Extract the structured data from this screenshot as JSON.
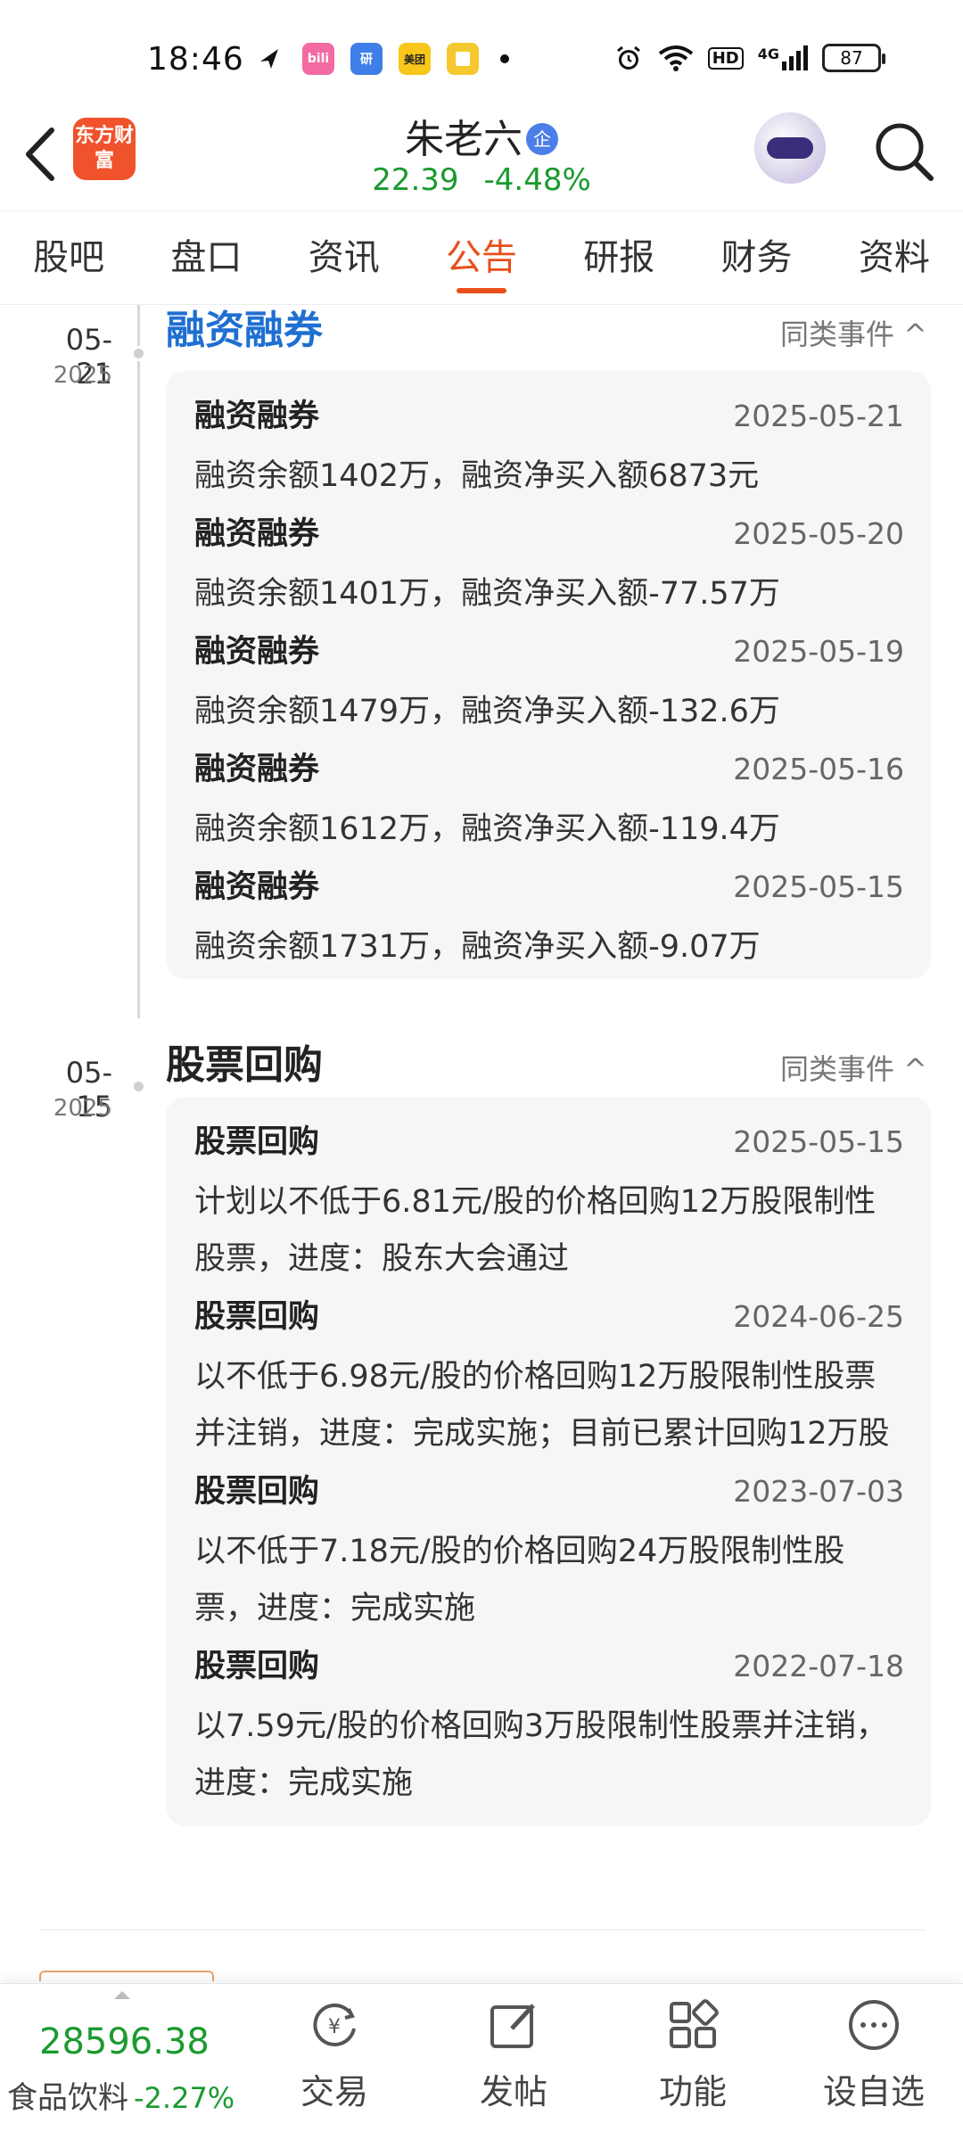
{
  "status_bar": {
    "time": "18:46",
    "app_icons": [
      "send-icon",
      "bilibili-icon",
      "research-app-icon",
      "meituan-icon",
      "notes-icon"
    ],
    "app_labels": [
      "",
      "bili",
      "研",
      "美团",
      ""
    ],
    "network": "4G",
    "hd": "HD",
    "battery": "87"
  },
  "header": {
    "logo_text": "东方财富",
    "stock_name": "朱老六",
    "enterprise_badge": "企",
    "price": "22.39",
    "change": "-4.48%"
  },
  "tabs": [
    {
      "label": "股吧",
      "active": false
    },
    {
      "label": "盘口",
      "active": false
    },
    {
      "label": "资讯",
      "active": false
    },
    {
      "label": "公告",
      "active": true
    },
    {
      "label": "研报",
      "active": false
    },
    {
      "label": "财务",
      "active": false
    },
    {
      "label": "资料",
      "active": false
    }
  ],
  "events": [
    {
      "date": "05-21",
      "year": "2025",
      "title": "融资融券",
      "title_color": "#1f6fd1",
      "similar_label": "同类事件 ^",
      "items": [
        {
          "title": "融资融券",
          "date": "2025-05-21",
          "desc": "融资余额1402万，融资净买入额6873元"
        },
        {
          "title": "融资融券",
          "date": "2025-05-20",
          "desc": "融资余额1401万，融资净买入额-77.57万"
        },
        {
          "title": "融资融券",
          "date": "2025-05-19",
          "desc": "融资余额1479万，融资净买入额-132.6万"
        },
        {
          "title": "融资融券",
          "date": "2025-05-16",
          "desc": "融资余额1612万，融资净买入额-119.4万"
        },
        {
          "title": "融资融券",
          "date": "2025-05-15",
          "desc": "融资余额1731万，融资净买入额-9.07万"
        }
      ]
    },
    {
      "date": "05-15",
      "year": "2025",
      "title": "股票回购",
      "title_color": "#222222",
      "similar_label": "同类事件 ^",
      "items": [
        {
          "title": "股票回购",
          "date": "2025-05-15",
          "desc": "计划以不低于6.81元/股的价格回购12万股限制性股票，进度：股东大会通过"
        },
        {
          "title": "股票回购",
          "date": "2024-06-25",
          "desc": "以不低于6.98元/股的价格回购12万股限制性股票并注销，进度：完成实施；目前已累计回购12万股"
        },
        {
          "title": "股票回购",
          "date": "2023-07-03",
          "desc": "以不低于7.18元/股的价格回购24万股限制性股票，进度：完成实施"
        },
        {
          "title": "股票回购",
          "date": "2022-07-18",
          "desc": "以7.59元/股的价格回购3万股限制性股票并注销，进度：完成实施"
        }
      ]
    }
  ],
  "bottom_bar": {
    "index_value": "28596.38",
    "index_name": "食品饮料",
    "index_change": "-2.27%",
    "nav": [
      {
        "label": "交易",
        "icon": "trade-icon"
      },
      {
        "label": "发帖",
        "icon": "post-icon"
      },
      {
        "label": "功能",
        "icon": "apps-icon"
      },
      {
        "label": "设自选",
        "icon": "add-watchlist-icon"
      }
    ]
  },
  "colors": {
    "accent": "#e94e1b",
    "down_green": "#1a9a2f",
    "link_blue": "#1f6fd1"
  }
}
